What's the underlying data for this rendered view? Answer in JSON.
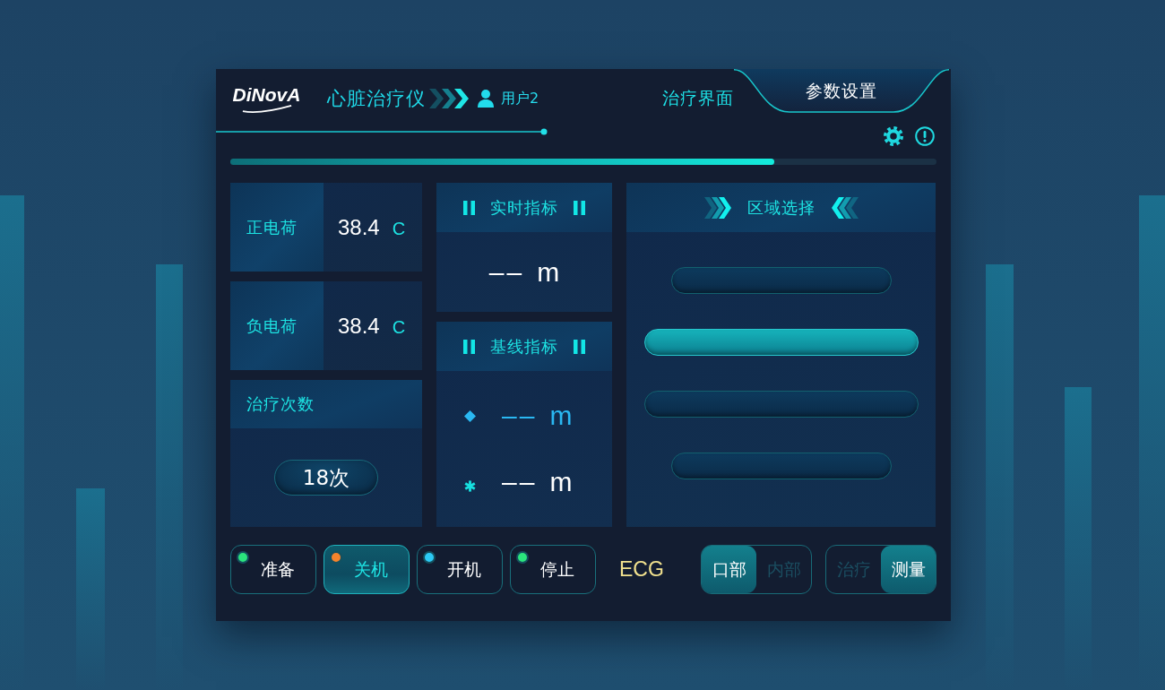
{
  "header": {
    "logo": "DiNovA",
    "title": "心脏治疗仪",
    "user": "用户2",
    "tabs": [
      {
        "label": "治疗界面",
        "selected": false
      },
      {
        "label": "参数设置",
        "selected": true
      }
    ]
  },
  "progress": {
    "level": 0.77
  },
  "charges": [
    {
      "label": "正电荷",
      "value": "38.4",
      "unit": "C"
    },
    {
      "label": "负电荷",
      "value": "38.4",
      "unit": "C"
    }
  ],
  "treatment_count": {
    "title": "治疗次数",
    "value": "18次"
  },
  "realtime": {
    "title": "实时指标",
    "value": "––",
    "unit": "m"
  },
  "baseline": {
    "title": "基线指标",
    "rows": [
      {
        "kind": "diamond",
        "color": "#2ab8f2",
        "value": "––",
        "unit": "m"
      },
      {
        "kind": "asterisk",
        "color": "#ffffff",
        "value": "––",
        "unit": "m"
      }
    ]
  },
  "regions": {
    "title": "区域选择",
    "items": [
      {
        "kind": "narrow",
        "selected": false
      },
      {
        "kind": "wide",
        "selected": true
      },
      {
        "kind": "wide",
        "selected": false
      },
      {
        "kind": "narrow",
        "selected": false
      }
    ]
  },
  "status_buttons": [
    {
      "label": "准备",
      "color": "#2be57d",
      "selected": false
    },
    {
      "label": "关机",
      "color": "#f5842c",
      "selected": true
    },
    {
      "label": "开机",
      "color": "#2cc9f5",
      "selected": false
    },
    {
      "label": "停止",
      "color": "#2be57d",
      "selected": false
    }
  ],
  "mode_label": "ECG",
  "toggles": [
    {
      "options": [
        {
          "label": "口部",
          "selected": true
        },
        {
          "label": "内部",
          "selected": false
        }
      ]
    },
    {
      "options": [
        {
          "label": "治疗",
          "selected": false
        },
        {
          "label": "测量",
          "selected": true
        }
      ]
    }
  ]
}
